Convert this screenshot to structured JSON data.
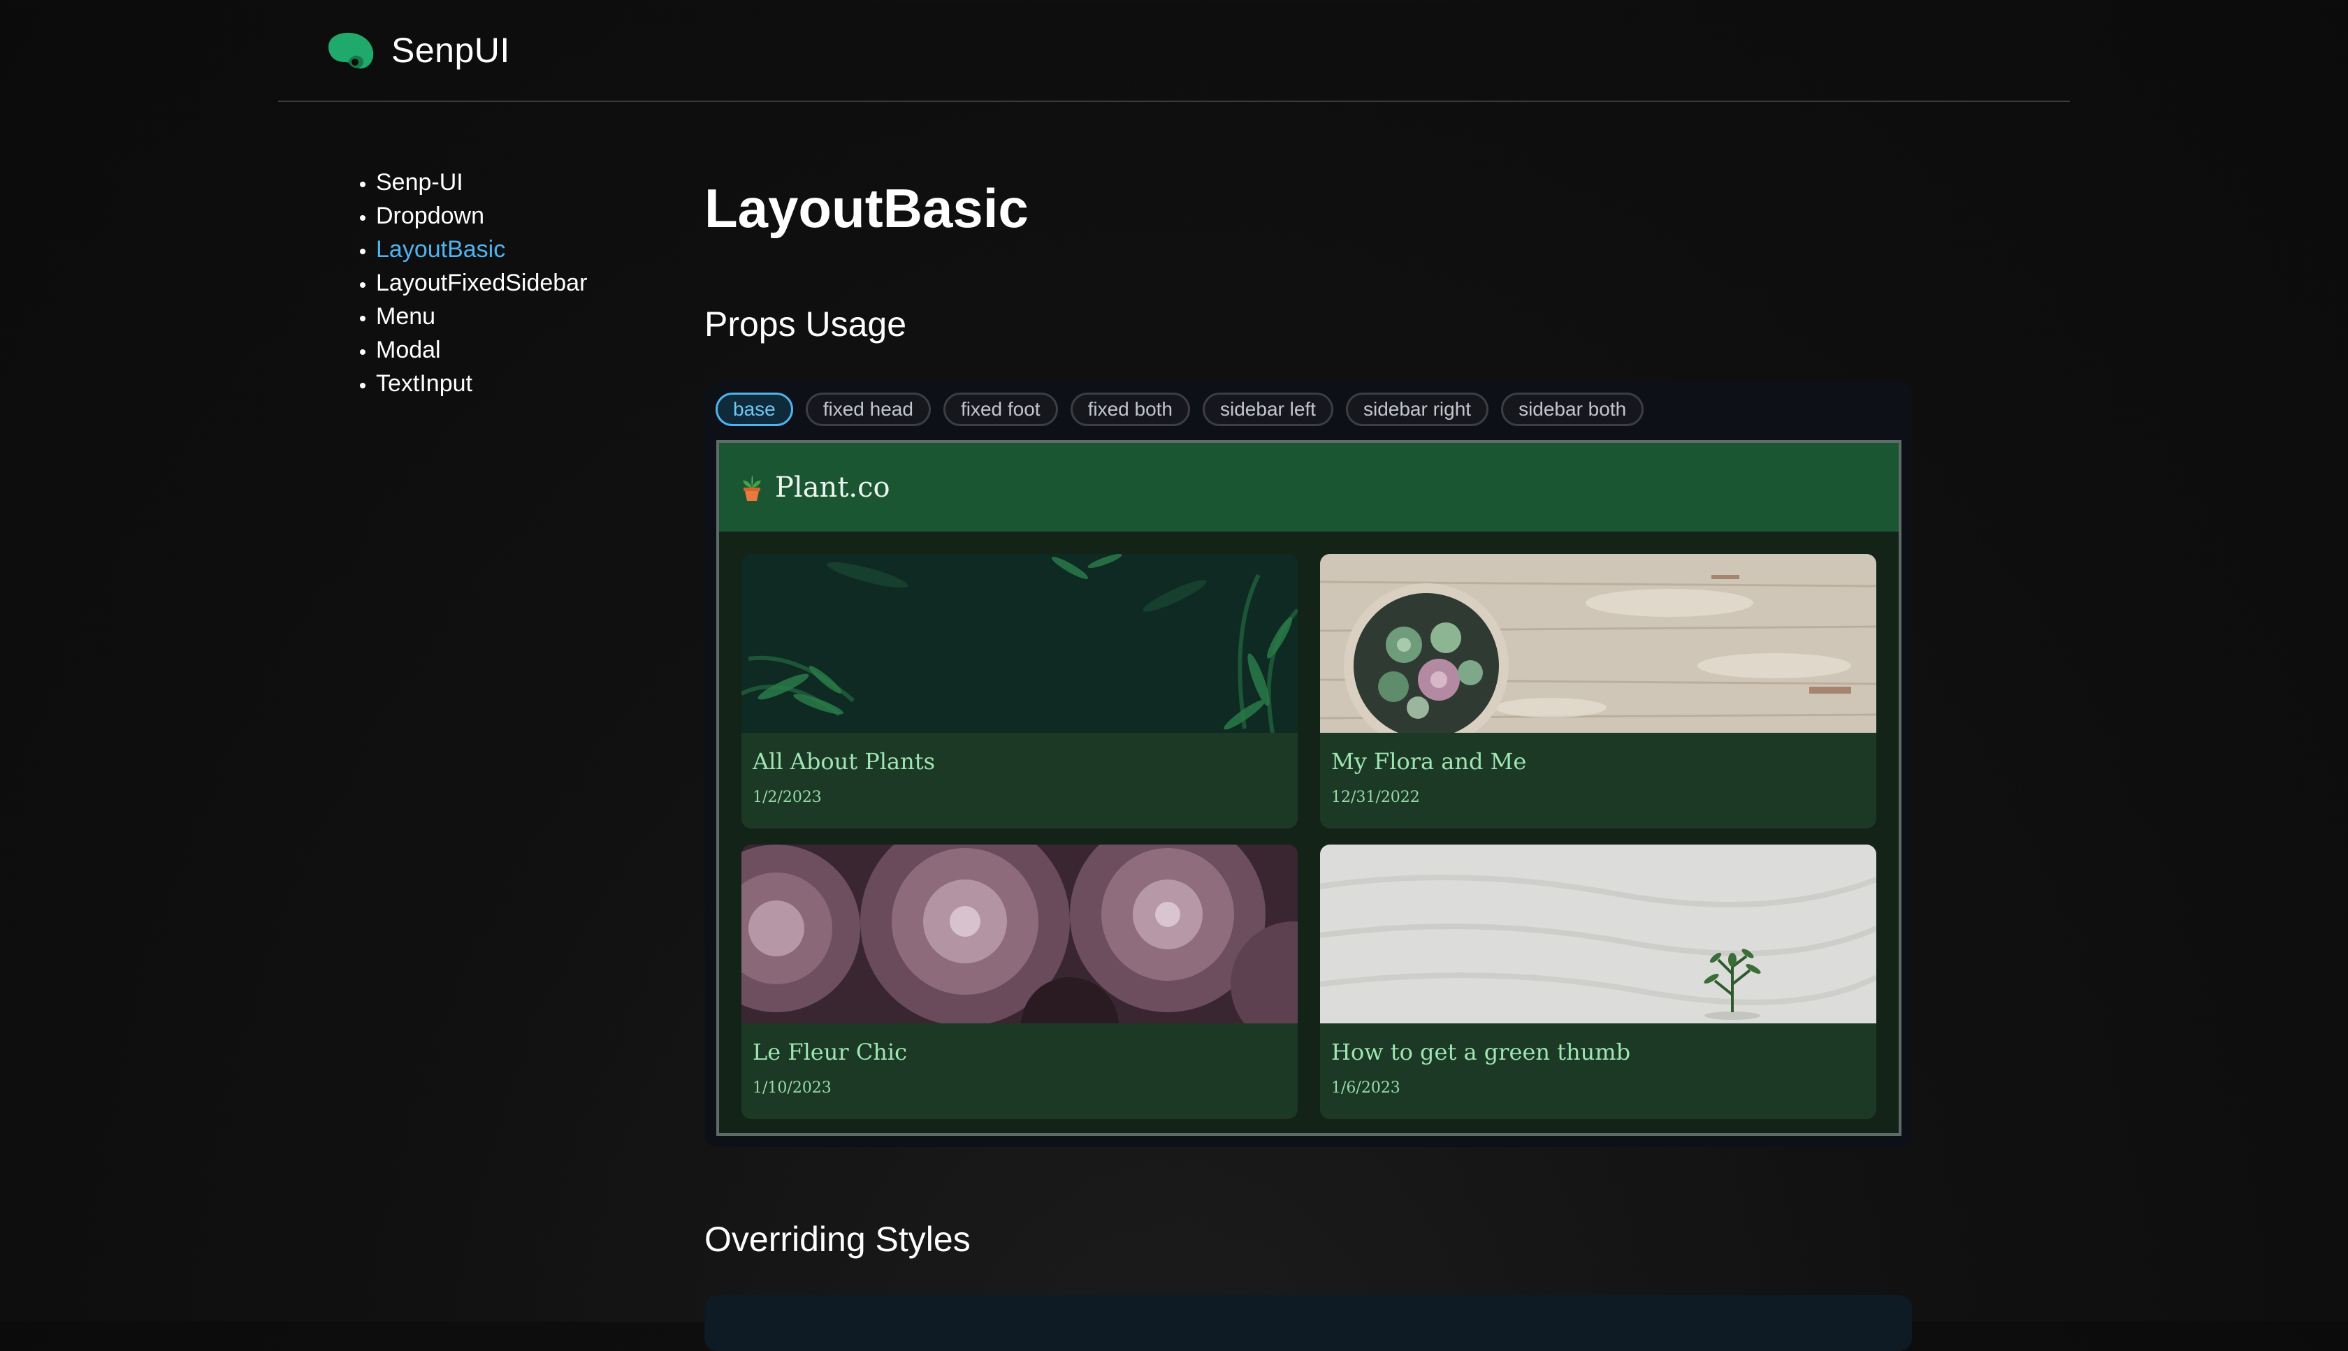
{
  "brand": {
    "name": "SenpUI",
    "logo_icon": "leaf-logo-icon",
    "accent": "#1faa6b"
  },
  "sidebar": {
    "items": [
      {
        "label": "Senp-UI",
        "active": false
      },
      {
        "label": "Dropdown",
        "active": false
      },
      {
        "label": "LayoutBasic",
        "active": true
      },
      {
        "label": "LayoutFixedSidebar",
        "active": false
      },
      {
        "label": "Menu",
        "active": false
      },
      {
        "label": "Modal",
        "active": false
      },
      {
        "label": "TextInput",
        "active": false
      }
    ],
    "active_color": "#4fb3ee"
  },
  "main": {
    "title": "LayoutBasic",
    "props_section": "Props Usage",
    "override_section": "Overriding Styles"
  },
  "props": {
    "options": [
      "base",
      "fixed head",
      "fixed foot",
      "fixed both",
      "sidebar left",
      "sidebar right",
      "sidebar both"
    ],
    "selected": "base"
  },
  "demo": {
    "brand": "Plant.co",
    "brand_icon": "potted-plant-icon",
    "header_color": "#1a5632",
    "cards": [
      {
        "title": "All About Plants",
        "date": "1/2/2023",
        "image": "fern-leaves-image"
      },
      {
        "title": "My Flora and Me",
        "date": "12/31/2022",
        "image": "succulent-bowl-image"
      },
      {
        "title": "Le Fleur Chic",
        "date": "1/10/2023",
        "image": "purple-succulents-image"
      },
      {
        "title": "How to get a green thumb",
        "date": "1/6/2023",
        "image": "sprout-in-sand-image"
      }
    ]
  }
}
